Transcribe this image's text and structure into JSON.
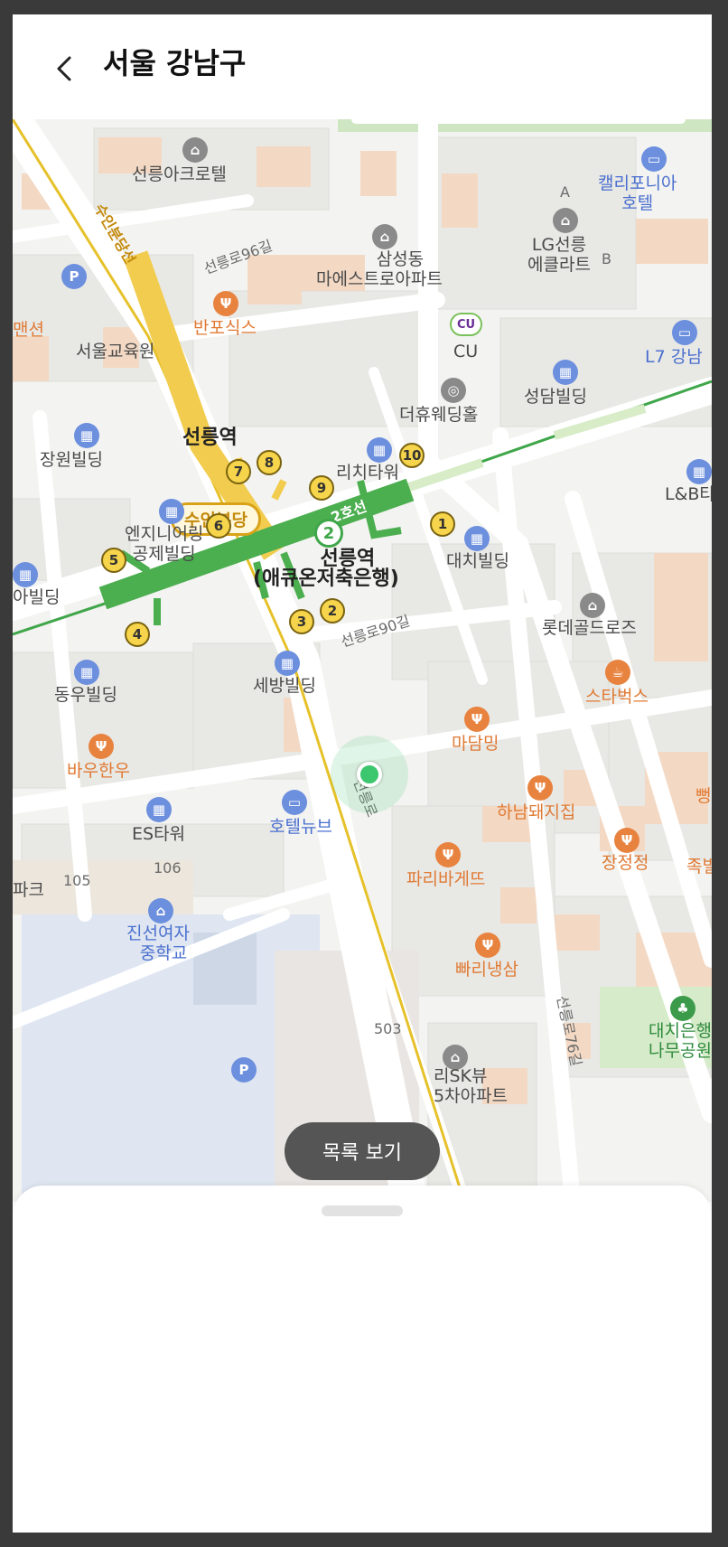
{
  "header": {
    "title": "서울 강남구",
    "back_icon": "chevron-left-icon"
  },
  "map": {
    "places": [
      {
        "name": "선릉아크로텔",
        "type": "building"
      },
      {
        "name": "캘리포니아\n호텔",
        "type": "hotel"
      },
      {
        "name": "LG선릉\n에클라트",
        "type": "building"
      },
      {
        "name": "삼성동\n마에스트로아파트",
        "type": "building"
      },
      {
        "name": "반포식스",
        "type": "restaurant"
      },
      {
        "name": "서울교육원",
        "type": "building"
      },
      {
        "name": "CU",
        "type": "store"
      },
      {
        "name": "L7 강남",
        "type": "hotel"
      },
      {
        "name": "성담빌딩",
        "type": "building"
      },
      {
        "name": "더휴웨딩홀",
        "type": "building"
      },
      {
        "name": "선릉역",
        "type": "station"
      },
      {
        "name": "장원빌딩",
        "type": "building"
      },
      {
        "name": "리치타워",
        "type": "building"
      },
      {
        "name": "L&B타워",
        "type": "building"
      },
      {
        "name": "엔지니어링\n공제빌딩",
        "type": "building"
      },
      {
        "name": "선릉역\n(애큐온저축은행)",
        "type": "station"
      },
      {
        "name": "대치빌딩",
        "type": "building"
      },
      {
        "name": "아빌딩",
        "type": "building"
      },
      {
        "name": "롯데골드로즈",
        "type": "building"
      },
      {
        "name": "동우빌딩",
        "type": "building"
      },
      {
        "name": "세방빌딩",
        "type": "building"
      },
      {
        "name": "스타벅스",
        "type": "cafe"
      },
      {
        "name": "마담밍",
        "type": "restaurant"
      },
      {
        "name": "바우한우",
        "type": "restaurant"
      },
      {
        "name": "하남돼지집",
        "type": "restaurant"
      },
      {
        "name": "ES타워",
        "type": "building"
      },
      {
        "name": "호텔뉴브",
        "type": "hotel"
      },
      {
        "name": "장정정",
        "type": "restaurant"
      },
      {
        "name": "파리바게뜨",
        "type": "restaurant"
      },
      {
        "name": "진선여자\n중학교",
        "type": "school"
      },
      {
        "name": "빠리냉삼",
        "type": "restaurant"
      },
      {
        "name": "대치은행\n나무공원",
        "type": "park"
      },
      {
        "name": "파크",
        "type": "building"
      },
      {
        "name": "리SK뷰\n5차아파트",
        "type": "building"
      },
      {
        "name": "뻥",
        "type": "restaurant"
      },
      {
        "name": "족빌",
        "type": "restaurant"
      },
      {
        "name": "맨션",
        "type": "building"
      }
    ],
    "roads": [
      "선릉로96길",
      "선릉로90길",
      "선릉로",
      "선릉로76길"
    ],
    "numbers": [
      "106",
      "105",
      "503"
    ],
    "lines": {
      "bundang_vertical": "수인분당선",
      "bundang_badge": "수인분당",
      "line2": "2호선",
      "line2_badge": "2"
    },
    "exits": [
      "1",
      "2",
      "3",
      "4",
      "5",
      "6",
      "7",
      "8",
      "9",
      "10"
    ],
    "letters": [
      "A",
      "B"
    ],
    "cu_logo": "CU",
    "parking": "P",
    "colors": {
      "line2": "#3fa64a",
      "bundang": "#f2c94c",
      "location": "#3cc66e"
    }
  },
  "list_button": {
    "label": "목록 보기"
  }
}
